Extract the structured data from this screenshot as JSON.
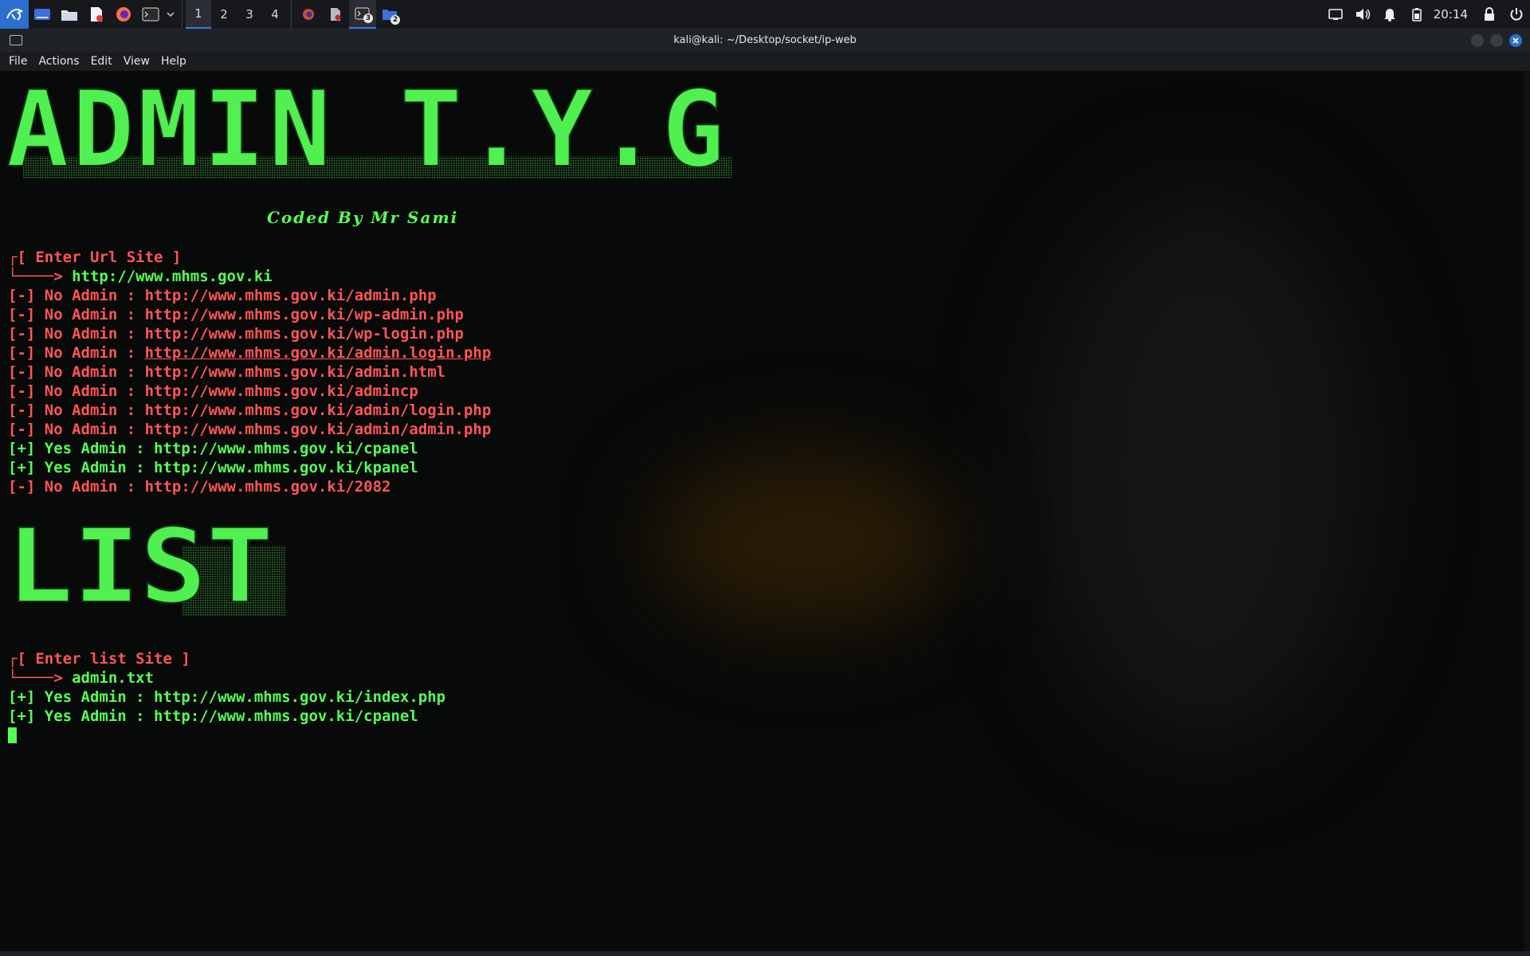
{
  "panel": {
    "workspaces": [
      "1",
      "2",
      "3",
      "4"
    ],
    "terminal_badge": "3",
    "files_badge": "2",
    "clock": "20:14"
  },
  "window": {
    "title": "kali@kali: ~/Desktop/socket/ip-web",
    "menu": [
      "File",
      "Actions",
      "Edit",
      "View",
      "Help"
    ]
  },
  "terminal": {
    "banner1": "ADMIN T.Y.G",
    "subtitle": "Coded By Mr Sami",
    "prompt1": "[ Enter Url Site ]",
    "arrow1": "└────>",
    "input1": "http://www.mhms.gov.ki",
    "results1": [
      {
        "tag": "[-] No Admin : ",
        "url": "http://www.mhms.gov.ki/admin.php",
        "status": "no"
      },
      {
        "tag": "[-] No Admin : ",
        "url": "http://www.mhms.gov.ki/wp-admin.php",
        "status": "no"
      },
      {
        "tag": "[-] No Admin : ",
        "url": "http://www.mhms.gov.ki/wp-login.php",
        "status": "no"
      },
      {
        "tag": "[-] No Admin : ",
        "url": "http://www.mhms.gov.ki/admin.login.php",
        "status": "no"
      },
      {
        "tag": "[-] No Admin : ",
        "url": "http://www.mhms.gov.ki/admin.html",
        "status": "no"
      },
      {
        "tag": "[-] No Admin : ",
        "url": "http://www.mhms.gov.ki/admincp",
        "status": "no"
      },
      {
        "tag": "[-] No Admin : ",
        "url": "http://www.mhms.gov.ki/admin/login.php",
        "status": "no"
      },
      {
        "tag": "[-] No Admin : ",
        "url": "http://www.mhms.gov.ki/admin/admin.php",
        "status": "no"
      },
      {
        "tag": "[+] Yes Admin : ",
        "url": "http://www.mhms.gov.ki/cpanel",
        "status": "yes"
      },
      {
        "tag": "[+] Yes Admin : ",
        "url": "http://www.mhms.gov.ki/kpanel",
        "status": "yes"
      },
      {
        "tag": "[-] No Admin : ",
        "url": "http://www.mhms.gov.ki/2082",
        "status": "no"
      }
    ],
    "banner2": "LIST",
    "prompt2": "[ Enter list Site ]",
    "arrow2": "└────>",
    "input2": "admin.txt",
    "results2": [
      {
        "tag": "[+] Yes Admin : ",
        "url": "http://www.mhms.gov.ki/index.php",
        "status": "yes"
      },
      {
        "tag": "[+] Yes Admin : ",
        "url": "http://www.mhms.gov.ki/cpanel",
        "status": "yes"
      }
    ]
  },
  "colors": {
    "red": "#ff5555",
    "green": "#55ff55",
    "accent": "#367bf0"
  }
}
